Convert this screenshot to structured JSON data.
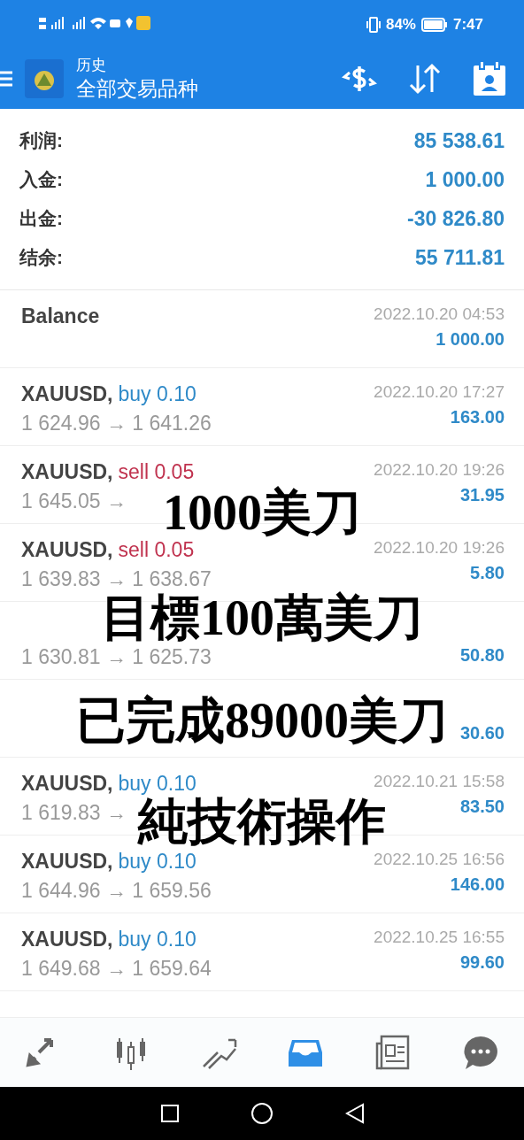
{
  "status_bar": {
    "battery": "84%",
    "time": "7:47"
  },
  "header": {
    "title": "历史",
    "subtitle": "全部交易品种"
  },
  "summary": [
    {
      "label": "利润:",
      "value": "85 538.61"
    },
    {
      "label": "入金:",
      "value": "1 000.00"
    },
    {
      "label": "出金:",
      "value": "-30 826.80"
    },
    {
      "label": "结余:",
      "value": "55 711.81"
    }
  ],
  "deals": [
    {
      "kind": "balance",
      "symbol": "Balance",
      "time": "2022.10.20 04:53",
      "amount": "1 000.00"
    },
    {
      "kind": "trade",
      "symbol": "XAUUSD,",
      "color": "#2f8ac8",
      "action": "buy 0.10",
      "prices": "1 624.96 → 1 641.26",
      "time": "2022.10.20 17:27",
      "amount": "163.00"
    },
    {
      "kind": "trade",
      "symbol": "XAUUSD,",
      "color": "#c0334f",
      "action": "sell 0.05",
      "prices": "1 645.05 →",
      "time": "2022.10.20 19:26",
      "amount": "31.95"
    },
    {
      "kind": "trade",
      "symbol": "XAUUSD,",
      "color": "#c0334f",
      "action": "sell 0.05",
      "prices": "1 639.83 → 1 638.67",
      "time": "2022.10.20 19:26",
      "amount": "5.80"
    },
    {
      "kind": "trade",
      "prices": "1 630.81 → 1 625.73",
      "amount": "50.80"
    },
    {
      "kind": "trade",
      "amount": "30.60"
    },
    {
      "kind": "trade",
      "symbol": "XAUUSD,",
      "color": "#2f8ac8",
      "action": "buy 0.10",
      "prices": "1 619.83 →",
      "time": "2022.10.21 15:58",
      "amount": "83.50"
    },
    {
      "kind": "trade",
      "symbol": "XAUUSD,",
      "color": "#2f8ac8",
      "action": "buy 0.10",
      "prices": "1 644.96 → 1 659.56",
      "time": "2022.10.25 16:56",
      "amount": "146.00"
    },
    {
      "kind": "trade",
      "symbol": "XAUUSD,",
      "color": "#2f8ac8",
      "action": "buy 0.10",
      "prices": "1 649.68 → 1 659.64",
      "time": "2022.10.25 16:55",
      "amount": "99.60"
    }
  ],
  "caption": [
    "1000美刀",
    "目標100萬美刀",
    "已完成89000美刀",
    "純技術操作"
  ],
  "bottom_nav": [
    {
      "kind": "quotes",
      "selected": false
    },
    {
      "kind": "chart",
      "selected": false
    },
    {
      "kind": "trade",
      "selected": false
    },
    {
      "kind": "history",
      "selected": true
    },
    {
      "kind": "news",
      "selected": false
    },
    {
      "kind": "chat",
      "selected": false
    }
  ]
}
